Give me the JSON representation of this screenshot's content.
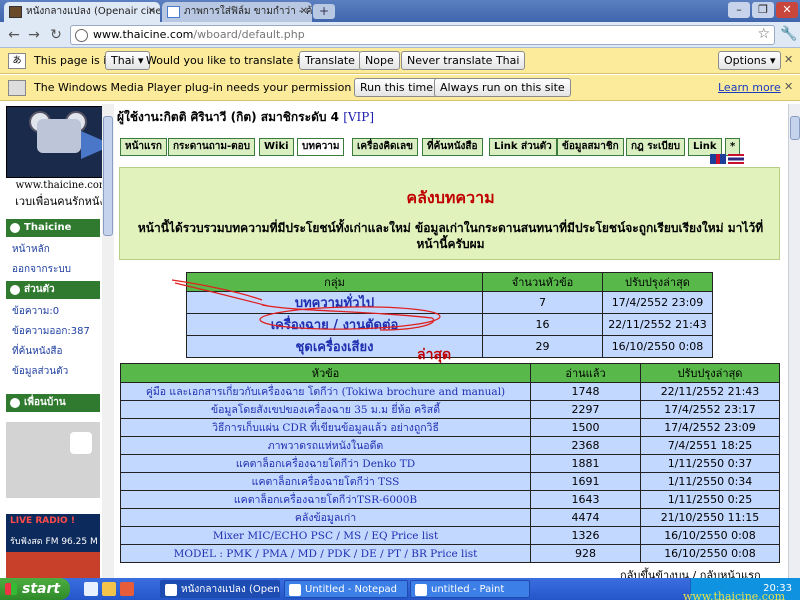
{
  "browser": {
    "tabs": [
      {
        "title": "หนังกลางแปลง (Openair cinema",
        "active": true
      },
      {
        "title": "ภาพการใส่ฟิล์ม ขามกำว่า - ค้นห",
        "active": false
      }
    ],
    "address": {
      "host": "www.thaicine.com",
      "path": "/wboard/default.php"
    },
    "window_controls": [
      "–",
      "❐",
      "✕"
    ]
  },
  "translate_bar": {
    "prefix": "This page is in",
    "language": "Thai",
    "question": "Would you like to translate it?",
    "translate_label": "Translate",
    "nope_label": "Nope",
    "never_label": "Never translate Thai",
    "options_label": "Options"
  },
  "plugin_bar": {
    "message": "The Windows Media Player plug-in needs your permission to run.",
    "run_once_label": "Run this time",
    "always_label": "Always run on this site",
    "learn_more_label": "Learn more"
  },
  "site": {
    "url_text": "www.thaicine.com",
    "slogan": "เวบเพื่อนคนรักหนัง",
    "user_line": "ผู้ใช้งาน:กิตติ ศิรินาวี (กิต) สมาชิกระดับ 4",
    "vip": "[VIP]"
  },
  "nav_tabs": [
    {
      "label": "หน้าแรก",
      "selected": false
    },
    {
      "label": "กระดานถาม-ตอบ",
      "selected": false
    },
    {
      "label": "Wiki",
      "selected": false
    },
    {
      "label": "บทความ",
      "selected": true
    },
    {
      "label": "เครื่องคิดเลข",
      "selected": false
    },
    {
      "label": "ที่ค้นหนังสือ",
      "selected": false
    },
    {
      "label": "Link ส่วนตัว",
      "selected": false
    },
    {
      "label": "ข้อมูลสมาชิก",
      "selected": false
    },
    {
      "label": "กฎ ระเบียบ",
      "selected": false
    },
    {
      "label": "Link",
      "selected": false
    },
    {
      "label": "*",
      "selected": false
    }
  ],
  "sidebar": {
    "sections": [
      {
        "header": "Thaicine",
        "items": [
          "หน้าหลัก",
          "ออกจากระบบ"
        ]
      },
      {
        "header": "ส่วนตัว",
        "items": [
          "ข้อความ:0",
          "ข้อความออก:387",
          "ที่ค้นหนังสือ",
          "ข้อมูลส่วนตัว"
        ]
      },
      {
        "header": "เพื่อนบ้าน",
        "items": []
      }
    ],
    "radio": {
      "live": "LIVE RADIO !",
      "fm": "รับฟังสด FM 96.25 M"
    }
  },
  "banner": {
    "title": "คลังบทความ",
    "description": "หน้านี้ได้รวบรวมบทความที่มีประโยชน์ทั้งเก่าและใหม่ ข้อมูลเก่าในกระดานสนทนาที่มีประโยชน์จะถูกเรียบเรียงใหม่ มาไว้ที่หน้านี้ครับผม"
  },
  "group_table": {
    "headers": [
      "กลุ่ม",
      "จำนวนหัวข้อ",
      "ปรับปรุงล่าสุด"
    ],
    "rows": [
      [
        "บทความทั่วไป",
        "7",
        "17/4/2552 23:09"
      ],
      [
        "เครื่องฉาย / งานตัดต่อ",
        "16",
        "22/11/2552 21:43"
      ],
      [
        "ชุดเครื่องเสียง",
        "29",
        "16/10/2550 0:08"
      ]
    ]
  },
  "latest": {
    "label": "ล่าสุด",
    "headers": [
      "หัวข้อ",
      "อ่านแล้ว",
      "ปรับปรุงล่าสุด"
    ],
    "rows": [
      [
        "คู่มือ และเอกสารเกี่ยวกับเครื่องฉาย โตกีว่า (Tokiwa brochure and manual)",
        "1748",
        "22/11/2552 21:43"
      ],
      [
        "ข้อมูลโดยสังเขปของเครื่องฉาย 35 ม.ม ยี่ห้อ คริสตี้",
        "2297",
        "17/4/2552 23:17"
      ],
      [
        "วิธีการเก็บแผ่น CDR ที่เขียนข้อมูลแล้ว อย่างถูกวิธี",
        "1500",
        "17/4/2552 23:09"
      ],
      [
        "ภาพวาดรถแห่หนังในอดีต",
        "2368",
        "7/4/2551 18:25"
      ],
      [
        "แคตาล็อกเครื่องฉายโตกีว่า Denko TD",
        "1881",
        "1/11/2550 0:37"
      ],
      [
        "แคตาล็อกเครื่องฉายโตกีว่า TSS",
        "1691",
        "1/11/2550 0:34"
      ],
      [
        "แคตาล็อกเครื่องฉายโตกีว่าTSR-6000B",
        "1643",
        "1/11/2550 0:25"
      ],
      [
        "คลังข้อมูลเก่า",
        "4474",
        "21/10/2550 11:15"
      ],
      [
        "Mixer MIC/ECHO PSC / MS / EQ Price list",
        "1326",
        "16/10/2550 0:08"
      ],
      [
        "MODEL : PMK / PMA / MD / PDK / DE / PT / BR Price list",
        "928",
        "16/10/2550 0:08"
      ]
    ]
  },
  "footer": {
    "link": "กลับขึ้นข้างบน / กลับหน้าแรก"
  },
  "taskbar": {
    "start_label": "start",
    "tasks": [
      "หนังกลางแปลง (Open...",
      "Untitled - Notepad",
      "untitled - Paint"
    ],
    "clock": "20:33",
    "watermark": "www.thaicine.com"
  },
  "icons": {
    "back": "←",
    "forward": "→",
    "reload": "↻",
    "star": "☆",
    "wrench": "🔧",
    "close": "✕"
  }
}
